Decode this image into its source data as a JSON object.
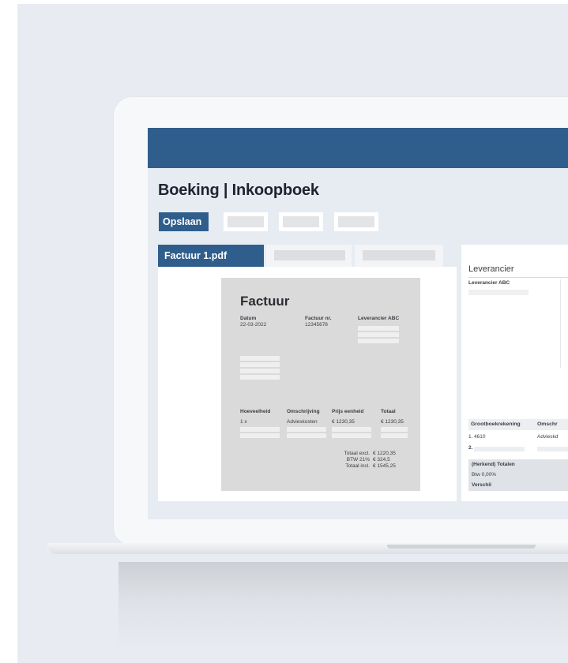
{
  "page": {
    "title": "Boeking | Inkoopboek",
    "save_label": "Opslaan",
    "active_tab": "Factuur 1.pdf"
  },
  "invoice": {
    "title": "Factuur",
    "date_label": "Datum",
    "date_value": "22-03-2022",
    "number_label": "Factuur nr.",
    "number_value": "12345678",
    "supplier": "Leverancier ABC",
    "columns": [
      "Hoeveelheid",
      "Omschrijving",
      "Prijs eenheid",
      "Totaal"
    ],
    "line": {
      "qty": "1 x",
      "description": "Advieskosten",
      "unit_price": "€ 1230,35",
      "total": "€ 1230,35"
    },
    "totals": [
      {
        "label": "Totaal excl.",
        "value": "€ 1220,35"
      },
      {
        "label": "BTW 21%",
        "value": "€ 324,5"
      },
      {
        "label": "Totaal incl.",
        "value": "€ 1545,25"
      }
    ]
  },
  "booking": {
    "supplier_title": "Leverancier",
    "supplier_value": "Leverancier ABC",
    "ledger_header": "Grootboekrekening",
    "description_header": "Omschr",
    "row1_index": "1.",
    "row1_account": "4610",
    "row1_description": "Advieskd",
    "row2_index": "2.",
    "totals_label": "(Herkend) Totalen",
    "vat_label": "Btw 0,00%",
    "difference_label": "Verschil"
  },
  "colors": {
    "primary": "#2f5e8c",
    "background": "#e8ecf2",
    "document": "#dadada"
  }
}
